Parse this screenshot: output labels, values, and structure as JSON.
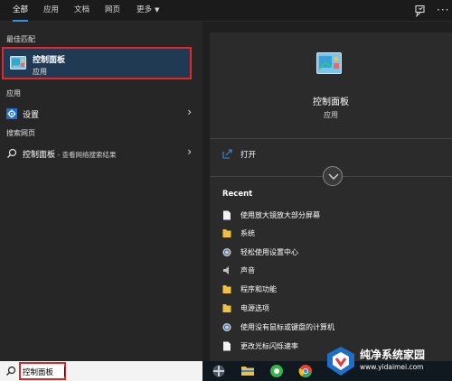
{
  "tabs": [
    {
      "label": "全部"
    },
    {
      "label": "应用"
    },
    {
      "label": "文档"
    },
    {
      "label": "网页"
    },
    {
      "label": "更多"
    }
  ],
  "left": {
    "best_match_heading": "最佳匹配",
    "best_match": {
      "title": "控制面板",
      "subtitle": "应用",
      "icon": "control-panel-icon"
    },
    "apps_heading": "应用",
    "apps": [
      {
        "label": "设置",
        "icon": "gear-icon"
      }
    ],
    "web_heading": "搜索网页",
    "web": [
      {
        "query": "控制面板",
        "suffix": " - 查看网络搜索结果",
        "icon": "search-icon"
      }
    ]
  },
  "search": {
    "value": "控制面板"
  },
  "right": {
    "title": "控制面板",
    "subtitle": "应用",
    "open_label": "打开",
    "recent_heading": "Recent",
    "recent": [
      {
        "label": "使用放大镜放大部分屏幕",
        "icon": "document-icon"
      },
      {
        "label": "系统",
        "icon": "folder-icon"
      },
      {
        "label": "轻松使用设置中心",
        "icon": "ease-of-access-icon"
      },
      {
        "label": "声音",
        "icon": "speaker-icon"
      },
      {
        "label": "程序和功能",
        "icon": "folder-icon"
      },
      {
        "label": "电源选项",
        "icon": "folder-icon"
      },
      {
        "label": "使用没有鼠标或键盘的计算机",
        "icon": "ease-of-access-icon"
      },
      {
        "label": "更改光标闪烁速率",
        "icon": "document-icon"
      }
    ]
  },
  "watermark": {
    "title": "纯净系统家园",
    "url": "www.yidaimei.com"
  },
  "colors": {
    "accent": "#3a8ee6",
    "highlight_border": "#e5252a",
    "selected_bg": "#1f3a52"
  }
}
